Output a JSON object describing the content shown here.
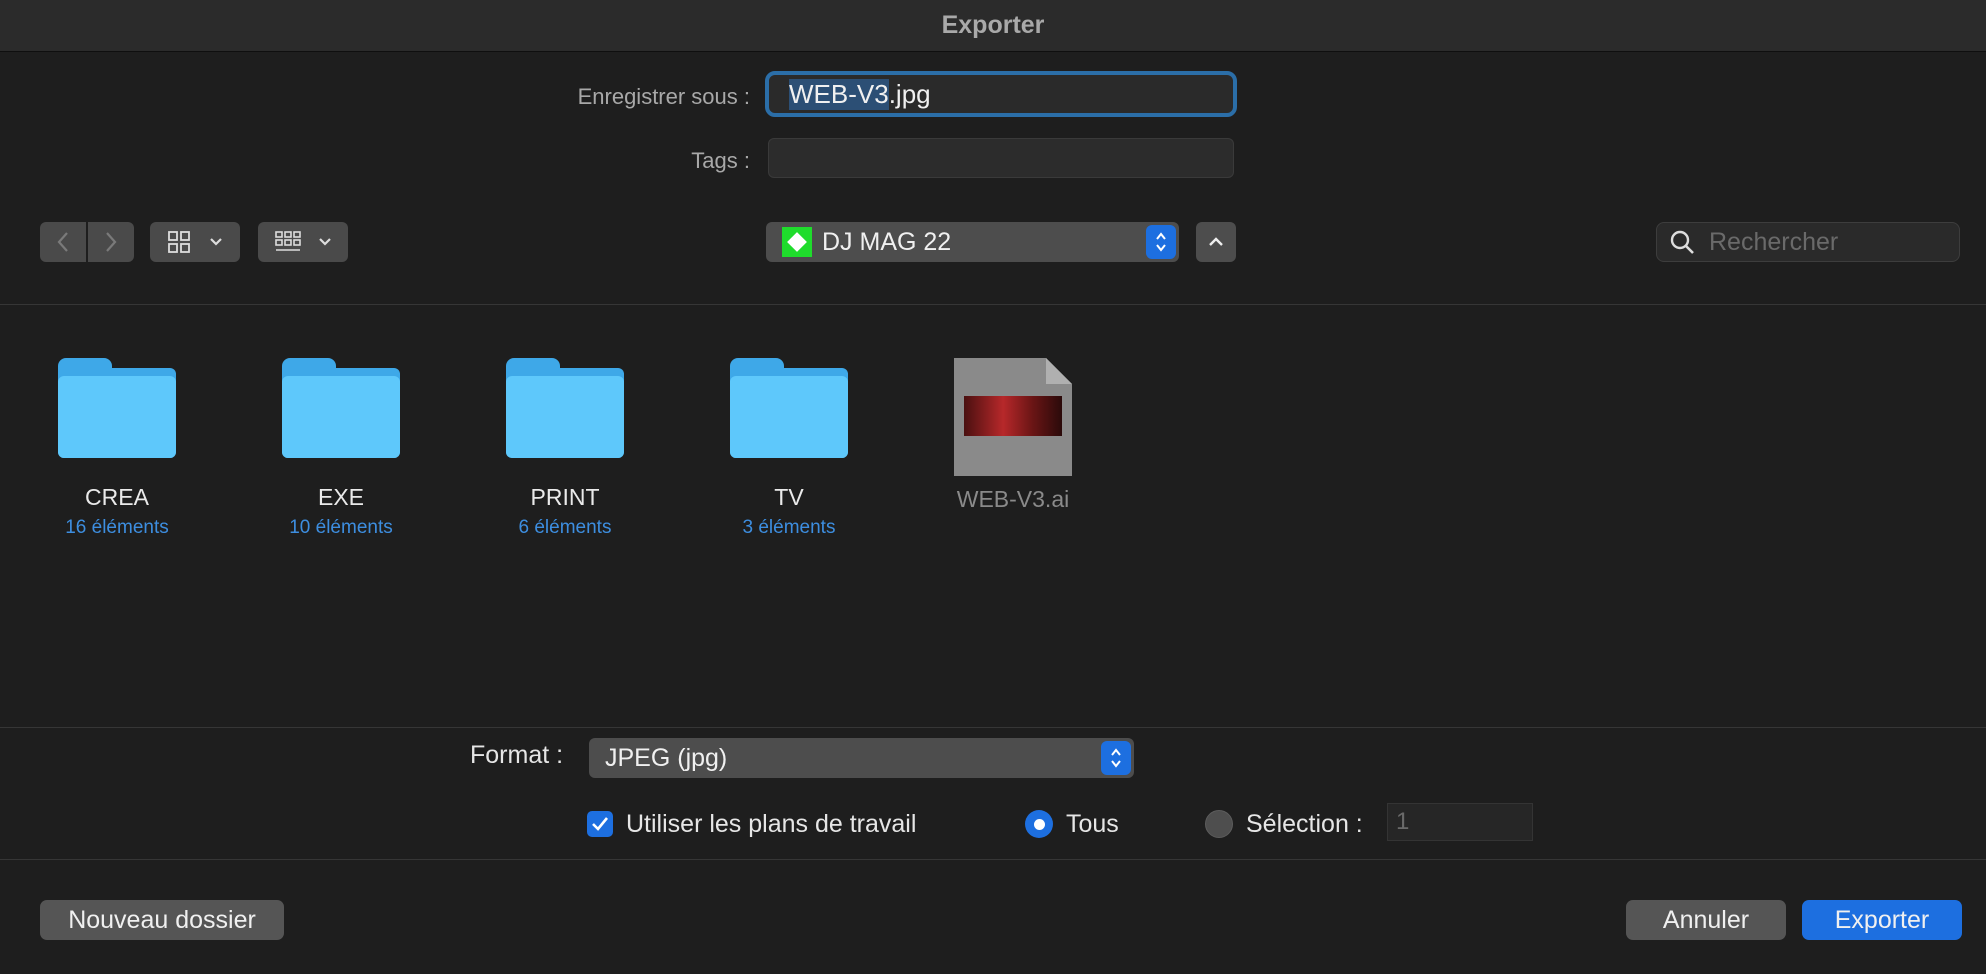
{
  "window": {
    "title": "Exporter"
  },
  "save_as": {
    "label": "Enregistrer sous :",
    "value_selected": "WEB-V3",
    "value_ext": ".jpg"
  },
  "tags": {
    "label": "Tags :",
    "value": ""
  },
  "location": {
    "name": "DJ MAG 22",
    "icon_color": "#1fdc2c"
  },
  "search": {
    "placeholder": "Rechercher"
  },
  "files": [
    {
      "name": "CREA",
      "count": "16 éléments"
    },
    {
      "name": "EXE",
      "count": "10 éléments"
    },
    {
      "name": "PRINT",
      "count": "6 éléments"
    },
    {
      "name": "TV",
      "count": "3 éléments"
    }
  ],
  "document": {
    "name": "WEB-V3.ai"
  },
  "format": {
    "label": "Format :",
    "value": "JPEG (jpg)"
  },
  "options": {
    "use_artboards": {
      "label": "Utiliser les plans de travail",
      "checked": true
    },
    "all": {
      "label": "Tous",
      "selected": true
    },
    "selection": {
      "label": "Sélection :",
      "selected": false,
      "placeholder": "1"
    }
  },
  "buttons": {
    "new_folder": "Nouveau dossier",
    "cancel": "Annuler",
    "export": "Exporter"
  },
  "colors": {
    "accent": "#1d6fe0",
    "folder": "#5ec8fb",
    "count_text": "#3d8ee0"
  }
}
